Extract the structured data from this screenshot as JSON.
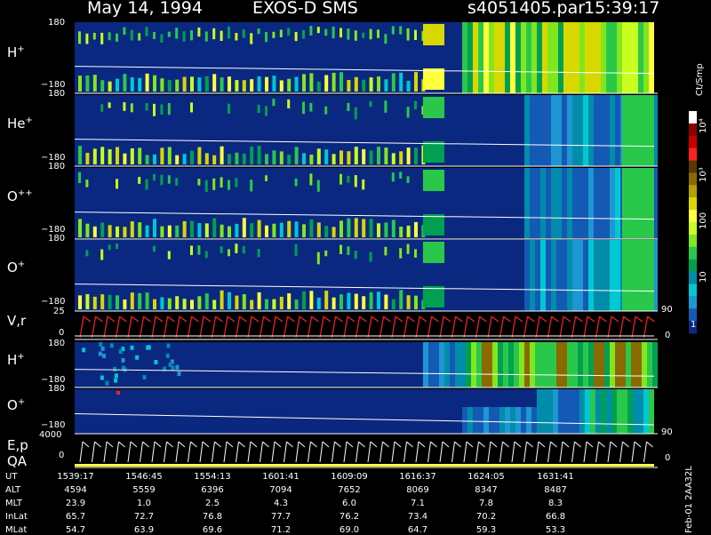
{
  "header": {
    "date": "May 14, 1994",
    "instrument": "EXOS-D SMS",
    "file": "s4051405.par",
    "time": "15:39:17"
  },
  "panels": [
    {
      "label": "H",
      "sup": "+",
      "top_tick": "180",
      "bottom_tick": "−180"
    },
    {
      "label": "He",
      "sup": "+",
      "top_tick": "180",
      "bottom_tick": "−180"
    },
    {
      "label": "O",
      "sup": "++",
      "top_tick": "180",
      "bottom_tick": "−180"
    },
    {
      "label": "O",
      "sup": "+",
      "top_tick": "180",
      "bottom_tick": "−180"
    },
    {
      "label": "V,r",
      "sup": "",
      "top_tick": "25",
      "bottom_tick": "0",
      "right_top": "90",
      "right_bottom": "0"
    },
    {
      "label": "H",
      "sup": "+",
      "top_tick": "180",
      "bottom_tick": "−180"
    },
    {
      "label": "O",
      "sup": "+",
      "top_tick": "180",
      "bottom_tick": "−180"
    },
    {
      "label": "E,p",
      "sub_label": "QA",
      "sup": "",
      "top_tick": "4000",
      "bottom_tick": "0",
      "right_top": "90",
      "right_bottom": "0"
    }
  ],
  "colorbar": {
    "unit": "Ct/Smp",
    "labels": [
      "10⁴",
      "10³",
      "100",
      "10",
      "1"
    ],
    "colors": [
      "#ffffff",
      "#8b0000",
      "#c80000",
      "#ff2020",
      "#5a3a00",
      "#8a6a00",
      "#b4a000",
      "#d8d800",
      "#ffff3c",
      "#c8ff1e",
      "#82e61e",
      "#2ac84a",
      "#00a050",
      "#008caa",
      "#00c8d2",
      "#1e96d2",
      "#145ab4",
      "#0a2880"
    ]
  },
  "footer": {
    "rows": [
      {
        "label": "UT",
        "values": [
          "1539:17",
          "1546:45",
          "1554:13",
          "1601:41",
          "1609:09",
          "1616:37",
          "1624:05",
          "1631:41"
        ]
      },
      {
        "label": "ALT",
        "values": [
          "4594",
          "5559",
          "6396",
          "7094",
          "7652",
          "8069",
          "8347",
          "8487"
        ]
      },
      {
        "label": "MLT",
        "values": [
          "23.9",
          "1.0",
          "2.5",
          "4.3",
          "6.0",
          "7.1",
          "7.8",
          "8.3"
        ]
      },
      {
        "label": "InLat",
        "values": [
          "65.7",
          "72.7",
          "76.8",
          "77.7",
          "76.2",
          "73.4",
          "70.2",
          "66.8"
        ]
      },
      {
        "label": "MLat",
        "values": [
          "54.7",
          "63.9",
          "69.6",
          "71.2",
          "69.0",
          "64.7",
          "59.3",
          "53.3"
        ]
      }
    ],
    "stamp": "Feb-01 2AA32L"
  },
  "chart_data": {
    "type": "heatmap",
    "title": "May 14, 1994   EXOS-D SMS",
    "x_ticks": [
      "1539:17",
      "1546:45",
      "1554:13",
      "1601:41",
      "1609:09",
      "1616:37",
      "1624:05",
      "1631:41"
    ],
    "colorbar_unit": "Ct/Smp",
    "colorbar_ticks": [
      "1",
      "10",
      "100",
      "10³",
      "10⁴"
    ],
    "panels": [
      {
        "name": "H+",
        "ylim": [
          -180,
          180
        ]
      },
      {
        "name": "He+",
        "ylim": [
          -180,
          180
        ]
      },
      {
        "name": "O++",
        "ylim": [
          -180,
          180
        ]
      },
      {
        "name": "O+",
        "ylim": [
          -180,
          180
        ]
      },
      {
        "name": "V,r",
        "ylim": [
          0,
          25
        ],
        "y2lim": [
          0,
          90
        ]
      },
      {
        "name": "H+",
        "ylim": [
          -180,
          180
        ]
      },
      {
        "name": "O+",
        "ylim": [
          -180,
          180
        ]
      },
      {
        "name": "E,p QA",
        "ylim": [
          0,
          4000
        ],
        "y2lim": [
          0,
          90
        ]
      }
    ]
  }
}
